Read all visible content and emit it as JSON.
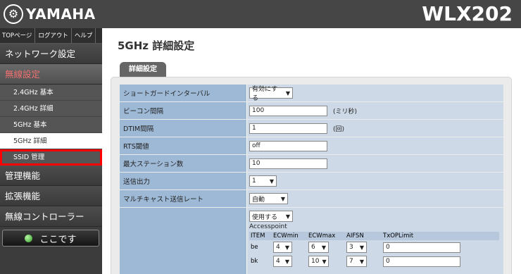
{
  "header": {
    "brand": "YAMAHA",
    "model": "WLX202"
  },
  "toplinks": [
    "TOPページ",
    "ログアウト",
    "ヘルプ"
  ],
  "nav": {
    "network": "ネットワーク設定",
    "wireless": "無線設定",
    "sub": [
      "2.4GHz 基本",
      "2.4GHz 詳細",
      "5GHz 基本",
      "5GHz 詳細",
      "SSID 管理"
    ],
    "management": "管理機能",
    "extension": "拡張機能",
    "controller": "無線コントローラー",
    "here_button": "ここです"
  },
  "main": {
    "title": "5GHz 詳細設定",
    "tab": "詳細設定",
    "rows": [
      {
        "label": "ショートガードインターバル",
        "value": "有効にする"
      },
      {
        "label": "ビーコン間隔",
        "value": "100",
        "unit": "(ミリ秒)"
      },
      {
        "label": "DTIM間隔",
        "value": "1",
        "unit": "(回)"
      },
      {
        "label": "RTS閾値",
        "value": "off"
      },
      {
        "label": "最大ステーション数",
        "value": "10"
      },
      {
        "label": "送信出力",
        "value": "1"
      },
      {
        "label": "マルチキャスト送信レート",
        "value": "自動"
      }
    ],
    "wmm": {
      "mode": "使用する",
      "section": "Accesspoint",
      "headers": [
        "ITEM",
        "ECWmin",
        "ECWmax",
        "AIFSN",
        "TxOPLimit"
      ],
      "rows": [
        {
          "item": "be",
          "ecwmin": "4",
          "ecwmax": "6",
          "aifsn": "3",
          "txop": "0"
        },
        {
          "item": "bk",
          "ecwmin": "4",
          "ecwmax": "10",
          "aifsn": "7",
          "txop": "0"
        }
      ]
    }
  },
  "colors": {
    "header_bg": "#464646",
    "sidebar_bg": "#3c3c3c",
    "label_bg": "#9eb9d6",
    "value_bg": "#cdd9e6",
    "highlight": "#ff0000",
    "active_section": "#f07070"
  }
}
